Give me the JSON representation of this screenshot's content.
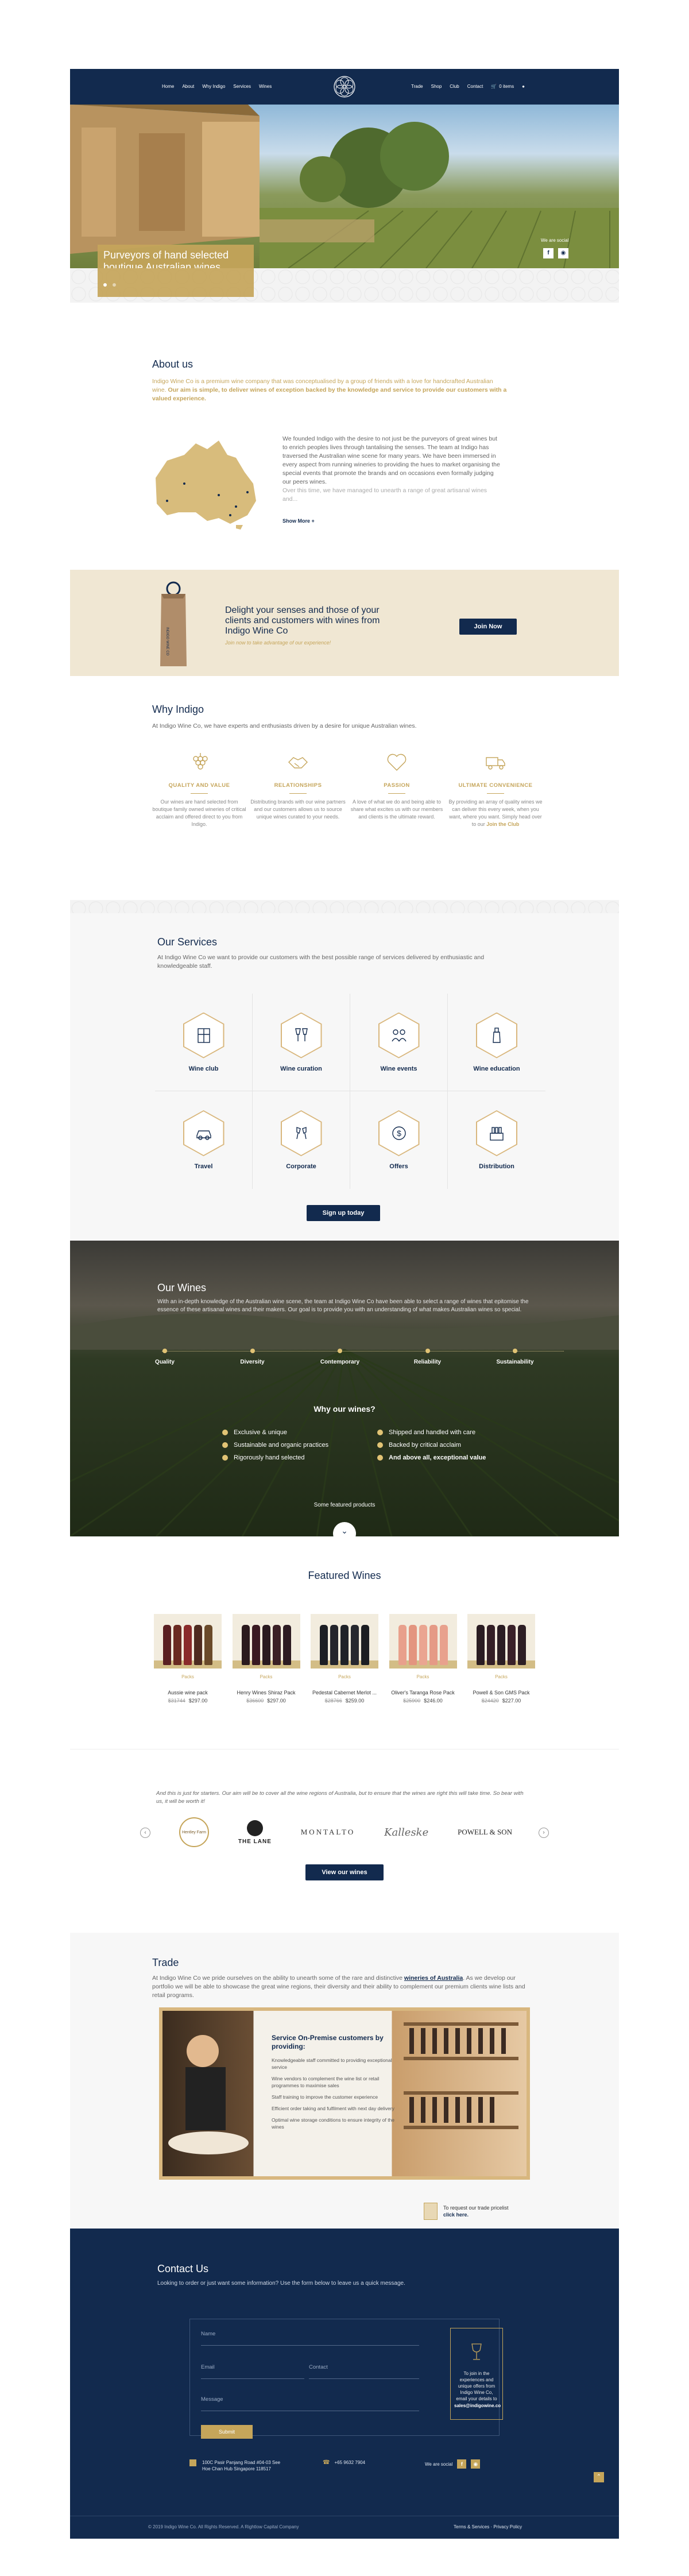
{
  "nav": {
    "left": [
      "Home",
      "About",
      "Why Indigo",
      "Services",
      "Wines"
    ],
    "right": [
      "Trade",
      "Shop",
      "Club",
      "Contact",
      "0 items"
    ]
  },
  "hero": {
    "title_line1": "Purveyors of hand selected",
    "title_line2": "boutique Australian wines",
    "social_label": "We are social"
  },
  "about": {
    "title": "About us",
    "intro": "Indigo Wine Co is a premium wine company that was conceptualised by a group of friends with a love for handcrafted Australian wine.",
    "intro_bold": "Our aim is simple, to deliver wines of exception backed by the knowledge and service to provide our customers with a valued experience.",
    "body": "We founded Indigo with the desire to not just be the purveyors of great wines but to enrich peoples lives through tantalising the senses. The team at Indigo has traversed the Australian wine scene for many years. We have been immersed in every aspect from running wineries to providing the hues to market organising the special events that promote the brands and on occasions even formally judging our peers wines.",
    "body2": "Over this time, we have managed to unearth a range of great artisanal wines and...",
    "show_more": "Show More +"
  },
  "promo": {
    "line1": "Delight your senses and those of your",
    "line2": "clients and customers with wines from",
    "line3": "Indigo Wine Co",
    "sub": "Join now to take advantage of our experience!",
    "button": "Join Now",
    "bag_text": "INDIGO WINE CO"
  },
  "why": {
    "title": "Why Indigo",
    "intro": "At Indigo Wine Co, we have experts and enthusiasts driven by a desire for unique Australian wines.",
    "cols": [
      {
        "title": "QUALITY AND VALUE",
        "text": "Our wines are hand selected from boutique family owned wineries of critical acclaim and offered direct to you from Indigo."
      },
      {
        "title": "RELATIONSHIPS",
        "text": "Distributing brands with our wine partners and our customers allows us to source unique wines curated to your needs."
      },
      {
        "title": "PASSION",
        "text": "A love of what we do and being able to share what excites us with our members and clients is the ultimate reward."
      },
      {
        "title": "ULTIMATE CONVENIENCE",
        "text": "By providing an array of quality wines we can deliver this every week, when you want, where you want. Simply head over to our",
        "link": "Join the Club"
      }
    ]
  },
  "services": {
    "title": "Our Services",
    "intro": "At Indigo Wine Co we want to provide our customers with the best possible range of services delivered by enthusiastic and knowledgeable staff.",
    "items": [
      "Wine club",
      "Wine curation",
      "Wine events",
      "Wine education",
      "Travel",
      "Corporate",
      "Offers",
      "Distribution"
    ],
    "button": "Sign up today"
  },
  "our_wines": {
    "title": "Our Wines",
    "text": "With an in-depth knowledge of the Australian wine scene, the team at Indigo Wine Co have been able to select a range of wines that epitomise the essence of these artisanal wines and their makers. Our goal is to provide you with an understanding of what makes Australian wines so special.",
    "steps": [
      "Quality",
      "Diversity",
      "Contemporary",
      "Reliability",
      "Sustainability"
    ],
    "why_title": "Why our wines?",
    "reasons_left": [
      "Exclusive & unique",
      "Sustainable and organic practices",
      "Rigorously hand selected"
    ],
    "reasons_right": [
      "Shipped and handled with care",
      "Backed by critical acclaim",
      "And above all, exceptional value"
    ],
    "featured_link": "Some featured products"
  },
  "featured": {
    "title": "Featured Wines",
    "products": [
      {
        "cat": "Packs",
        "name": "Aussie wine pack",
        "old": "$31744",
        "price": "$297.00"
      },
      {
        "cat": "Packs",
        "name": "Henry Wines Shiraz Pack",
        "old": "$36600",
        "price": "$297.00"
      },
      {
        "cat": "Packs",
        "name": "Pedestal Cabernet Merlot ...",
        "old": "$28766",
        "price": "$259.00"
      },
      {
        "cat": "Packs",
        "name": "Oliver's Taranga Rose Pack",
        "old": "$25900",
        "price": "$246.00"
      },
      {
        "cat": "Packs",
        "name": "Powell & Son GMS Pack",
        "old": "$24420",
        "price": "$227.00"
      }
    ]
  },
  "brands": {
    "note": "And this is just for starters. Our aim will be to cover all the wine regions of Australia, but to ensure that the wines are right this will take time. So bear with us, it will be worth it!",
    "logos": [
      "Hentley Farm",
      "THE LANE",
      "MONTALTO",
      "Kalleske",
      "POWELL & SON"
    ],
    "button": "View our wines"
  },
  "trade": {
    "title": "Trade",
    "intro_a": "At Indigo Wine Co we pride ourselves on the ability to unearth some of the rare and distinctive",
    "intro_link": "wineries of Australia",
    "intro_b": ". As we develop our portfolio we will be able to showcase the great wine regions, their diversity and their ability to complement our premium clients wine lists and retail programs.",
    "card_title": "Service On-Premise customers by providing:",
    "card_points": [
      "Knowledgeable staff committed to providing exceptional service",
      "Wine vendors to complement the wine list or retail programmes to maximise sales",
      "Staff training to improve the customer experience",
      "Efficient order taking and fulfilment with next day delivery",
      "Optimal wine storage conditions to ensure integrity of the wines"
    ],
    "pricelist_text": "To request our trade pricelist",
    "pricelist_link": "click here."
  },
  "contact": {
    "title": "Contact Us",
    "intro": "Looking to order or just want some information? Use the form below to leave us a quick message.",
    "name_label": "Name",
    "email_label": "Email",
    "contact_label": "Contact",
    "message_label": "Message",
    "submit": "Submit",
    "side_text": "To join in the experiences and unique offers from Indigo Wine Co, email your details to",
    "side_email": "sales@indigowine.co",
    "address": "100C Pasir Panjang Road #04-03 See Hoe Chan Hub Singapore 118517",
    "phone": "+65 9632 7904",
    "social_label": "We are social"
  },
  "footer": {
    "copyright": "© 2019 Indigo Wine Co. All Rights Reserved. A Rightlow Capital Company",
    "links": "Terms & Services  ·  Privacy Policy"
  },
  "colors": {
    "navy": "#122a4e",
    "gold": "#c5a55a",
    "cream": "#f0e7d3"
  }
}
